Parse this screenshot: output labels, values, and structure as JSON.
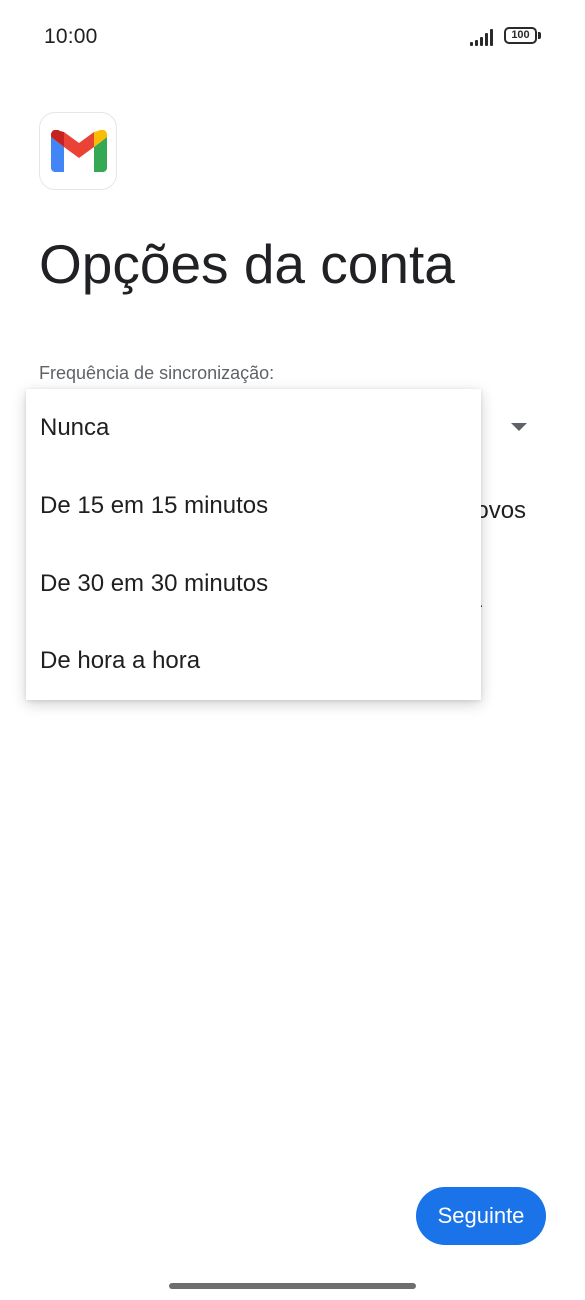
{
  "status_bar": {
    "time": "10:00",
    "battery_level": "100",
    "signal_icon": "signal-bars-icon",
    "battery_icon": "battery-icon"
  },
  "app": {
    "logo_icon": "gmail-logo-icon",
    "title": "Opções da conta"
  },
  "sync": {
    "label": "Frequência de sincronização:",
    "arrow_icon": "dropdown-arrow-icon",
    "options": [
      "Nunca",
      "De 15 em 15 minutos",
      "De 30 em 30 minutos",
      "De hora a hora"
    ]
  },
  "background_partial_text": {
    "line_1": "novos",
    "line_2": "ta"
  },
  "footer": {
    "next_label": "Seguinte",
    "button_color": "#1a73e8"
  }
}
